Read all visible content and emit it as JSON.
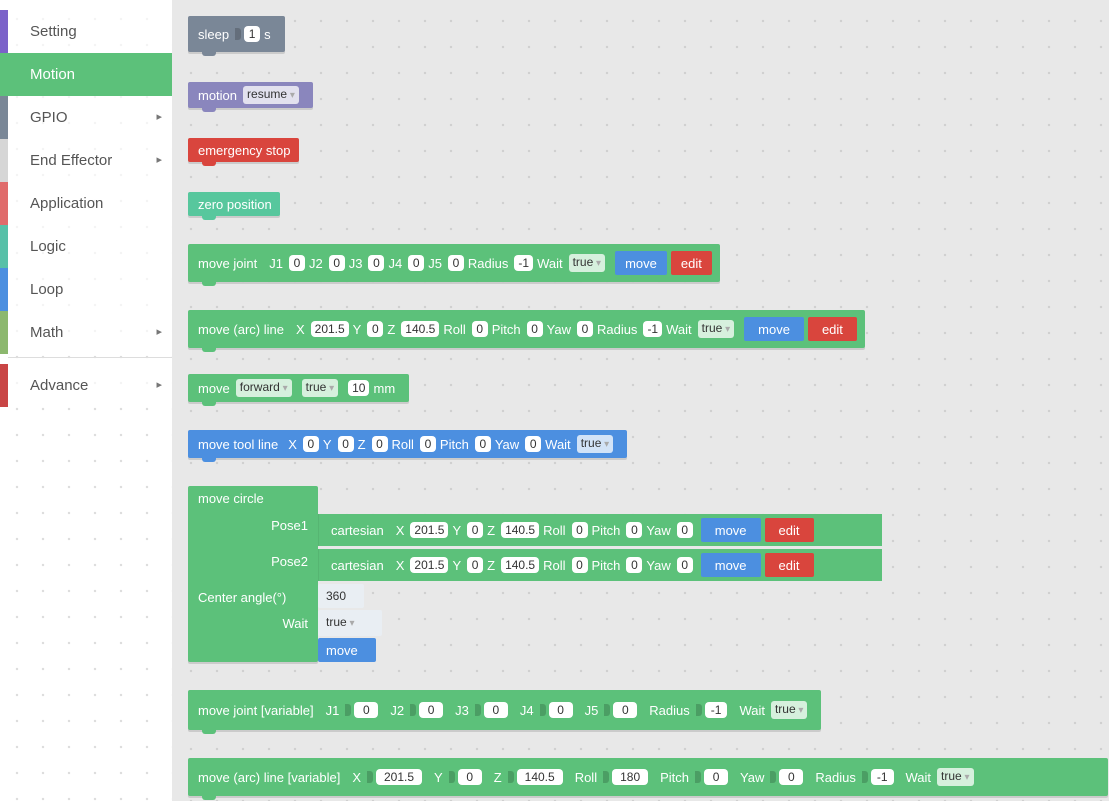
{
  "sidebar": {
    "categories": [
      {
        "label": "Setting",
        "color": "#7b62c9",
        "has_submenu": false
      },
      {
        "label": "Motion",
        "color": "#5cc17a",
        "has_submenu": false,
        "selected": true
      },
      {
        "label": "GPIO",
        "color": "#7a8797",
        "has_submenu": true
      },
      {
        "label": "End Effector",
        "color": "#cfcfcf",
        "has_submenu": true
      },
      {
        "label": "Application",
        "color": "#e06b6b",
        "has_submenu": false
      },
      {
        "label": "Logic",
        "color": "#57c0a8",
        "has_submenu": false
      },
      {
        "label": "Loop",
        "color": "#4c8fe0",
        "has_submenu": false
      },
      {
        "label": "Math",
        "color": "#8cb86e",
        "has_submenu": true
      },
      {
        "label": "Advance",
        "color": "#c94545",
        "has_submenu": true
      }
    ],
    "submenu_icon": "chevron-right-icon"
  },
  "blocks": {
    "sleep": {
      "label": "sleep",
      "value": "1",
      "unit": "s"
    },
    "motion": {
      "label": "motion",
      "option": "resume"
    },
    "emergency": {
      "label": "emergency stop"
    },
    "zero": {
      "label": "zero position"
    },
    "move_joint": {
      "label": "move joint",
      "fields": [
        {
          "name": "J1",
          "value": "0"
        },
        {
          "name": "J2",
          "value": "0"
        },
        {
          "name": "J3",
          "value": "0"
        },
        {
          "name": "J4",
          "value": "0"
        },
        {
          "name": "J5",
          "value": "0"
        },
        {
          "name": "Radius",
          "value": "-1"
        }
      ],
      "wait_label": "Wait",
      "wait_value": "true",
      "move_label": "move",
      "edit_label": "edit"
    },
    "move_arc": {
      "label": "move (arc) line",
      "fields": [
        {
          "name": "X",
          "value": "201.5"
        },
        {
          "name": "Y",
          "value": "0"
        },
        {
          "name": "Z",
          "value": "140.5"
        },
        {
          "name": "Roll",
          "value": "0"
        },
        {
          "name": "Pitch",
          "value": "0"
        },
        {
          "name": "Yaw",
          "value": "0"
        },
        {
          "name": "Radius",
          "value": "-1"
        }
      ],
      "wait_label": "Wait",
      "wait_value": "true",
      "move_label": "move",
      "edit_label": "edit"
    },
    "move_forward": {
      "label": "move",
      "direction": "forward",
      "flag": "true",
      "value": "10",
      "unit": "mm"
    },
    "tool_line": {
      "label": "move tool line",
      "fields": [
        {
          "name": "X",
          "value": "0"
        },
        {
          "name": "Y",
          "value": "0"
        },
        {
          "name": "Z",
          "value": "0"
        },
        {
          "name": "Roll",
          "value": "0"
        },
        {
          "name": "Pitch",
          "value": "0"
        },
        {
          "name": "Yaw",
          "value": "0"
        }
      ],
      "wait_label": "Wait",
      "wait_value": "true"
    },
    "move_circle": {
      "label": "move circle",
      "pose1_label": "Pose1",
      "pose2_label": "Pose2",
      "center_label": "Center angle(°)",
      "center_value": "360",
      "wait_label": "Wait",
      "wait_value": "true",
      "move_label": "move",
      "pose": {
        "label": "cartesian",
        "fields": [
          {
            "name": "X",
            "value": "201.5"
          },
          {
            "name": "Y",
            "value": "0"
          },
          {
            "name": "Z",
            "value": "140.5"
          },
          {
            "name": "Roll",
            "value": "0"
          },
          {
            "name": "Pitch",
            "value": "0"
          },
          {
            "name": "Yaw",
            "value": "0"
          }
        ],
        "move_label": "move",
        "edit_label": "edit"
      }
    },
    "joint_var": {
      "label": "move joint [variable]",
      "fields": [
        {
          "name": "J1",
          "value": "0"
        },
        {
          "name": "J2",
          "value": "0"
        },
        {
          "name": "J3",
          "value": "0"
        },
        {
          "name": "J4",
          "value": "0"
        },
        {
          "name": "J5",
          "value": "0"
        },
        {
          "name": "Radius",
          "value": "-1"
        }
      ],
      "wait_label": "Wait",
      "wait_value": "true"
    },
    "arc_var": {
      "label": "move (arc) line [variable]",
      "fields": [
        {
          "name": "X",
          "value": "201.5"
        },
        {
          "name": "Y",
          "value": "0"
        },
        {
          "name": "Z",
          "value": "140.5"
        },
        {
          "name": "Roll",
          "value": "180"
        },
        {
          "name": "Pitch",
          "value": "0"
        },
        {
          "name": "Yaw",
          "value": "0"
        },
        {
          "name": "Radius",
          "value": "-1"
        }
      ],
      "wait_label": "Wait",
      "wait_value": "true"
    }
  }
}
